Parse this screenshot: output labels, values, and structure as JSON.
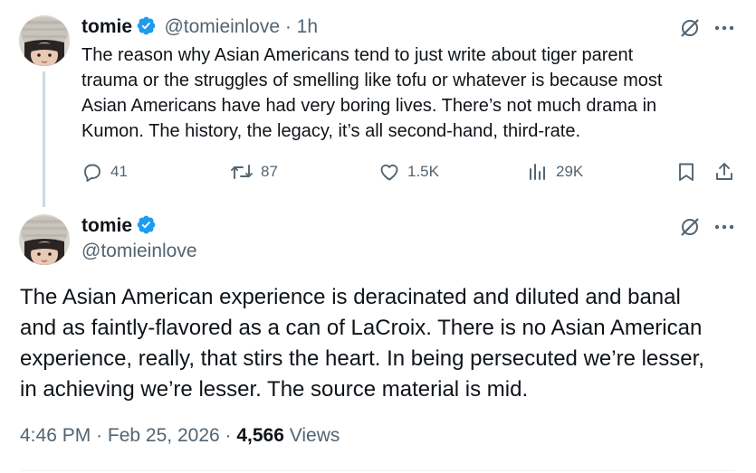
{
  "parent_tweet": {
    "display_name": "tomie",
    "handle": "@tomieinlove",
    "time": "· 1h",
    "text_lines": [
      "The reason why Asian Americans tend to just write about tiger parent",
      "trauma or the struggles of smelling like tofu or whatever is because most",
      "Asian Americans have had very boring lives. There’s not much drama in",
      "Kumon. The history, the legacy, it’s all second-hand, third-rate."
    ],
    "actions": {
      "replies": "41",
      "reposts": "87",
      "likes": "1.5K",
      "views": "29K"
    }
  },
  "main_tweet": {
    "display_name": "tomie",
    "handle": "@tomieinlove",
    "text_lines": [
      "The Asian American experience is deracinated and diluted and banal",
      "and as faintly-flavored as a can of LaCroix. There is no Asian American",
      "experience, really, that stirs the heart. In being persecuted we’re lesser,",
      "in achieving we’re lesser. The source material is mid."
    ],
    "time": "4:46 PM",
    "date": "Feb 25, 2026",
    "views_count": "4,566",
    "views_label": "Views",
    "separator": "·"
  },
  "icons": {
    "verified": "verified-badge-icon",
    "grok": "grok-icon",
    "more": "more-icon",
    "reply": "reply-icon",
    "repost": "repost-icon",
    "like": "like-icon",
    "views": "views-icon",
    "bookmark": "bookmark-icon",
    "share": "share-icon"
  },
  "colors": {
    "verified_blue": "#1d9bf0",
    "text": "#0f1419",
    "muted": "#536471"
  }
}
